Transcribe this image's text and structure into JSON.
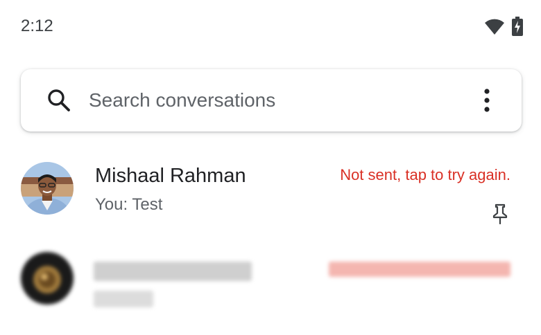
{
  "status_bar": {
    "time": "2:12",
    "icons": [
      "wifi-icon",
      "battery-charging-icon"
    ]
  },
  "search": {
    "placeholder": "Search conversations",
    "icon": "search-icon",
    "menu_icon": "more-vert-icon"
  },
  "conversations": [
    {
      "name": "Mishaal Rahman",
      "snippet": "You: Test",
      "status": "Not sent, tap to try again.",
      "pinned": true,
      "pin_icon": "pin-icon"
    },
    {
      "blurred": true
    }
  ],
  "colors": {
    "error": "#d93025",
    "text_primary": "#202124",
    "text_secondary": "#5f6368"
  }
}
